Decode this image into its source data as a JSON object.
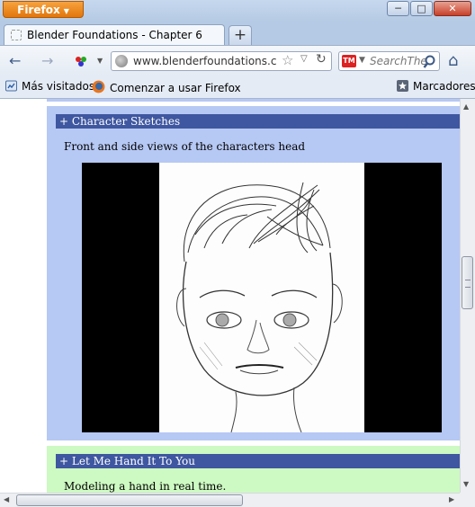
{
  "window": {
    "app_button": "Firefox",
    "minimize": "─",
    "maximize": "□",
    "close": "✕"
  },
  "tabs": [
    {
      "label": "Blender Foundations - Chapter 6"
    }
  ],
  "newtab_label": "+",
  "navbar": {
    "back": "←",
    "forward": "→",
    "url": "www.blenderfoundations.com",
    "search_placeholder": "SearchThe",
    "search_engine": "TM",
    "home": "⌂"
  },
  "bookmarks": {
    "items": [
      {
        "label": "Más visitados"
      },
      {
        "label": "Comenzar a usar Firefox"
      }
    ],
    "menu_label": "Marcadores"
  },
  "page": {
    "sections": [
      {
        "header": "+ Character Sketches",
        "description": "Front and side views of the characters head",
        "bg_color": "#b6c8f4"
      },
      {
        "header": "+ Let Me Hand It To You",
        "description": "Modeling a hand in real time.",
        "bg_color": "#cdf9c2"
      }
    ],
    "header_color": "#3f57a0"
  },
  "icons": {
    "back": "back-arrow-icon",
    "forward": "forward-arrow-icon",
    "site": "globe-icon",
    "bookmark_star": "star-icon",
    "reload": "reload-icon",
    "search": "magnifier-icon",
    "home": "home-icon"
  }
}
